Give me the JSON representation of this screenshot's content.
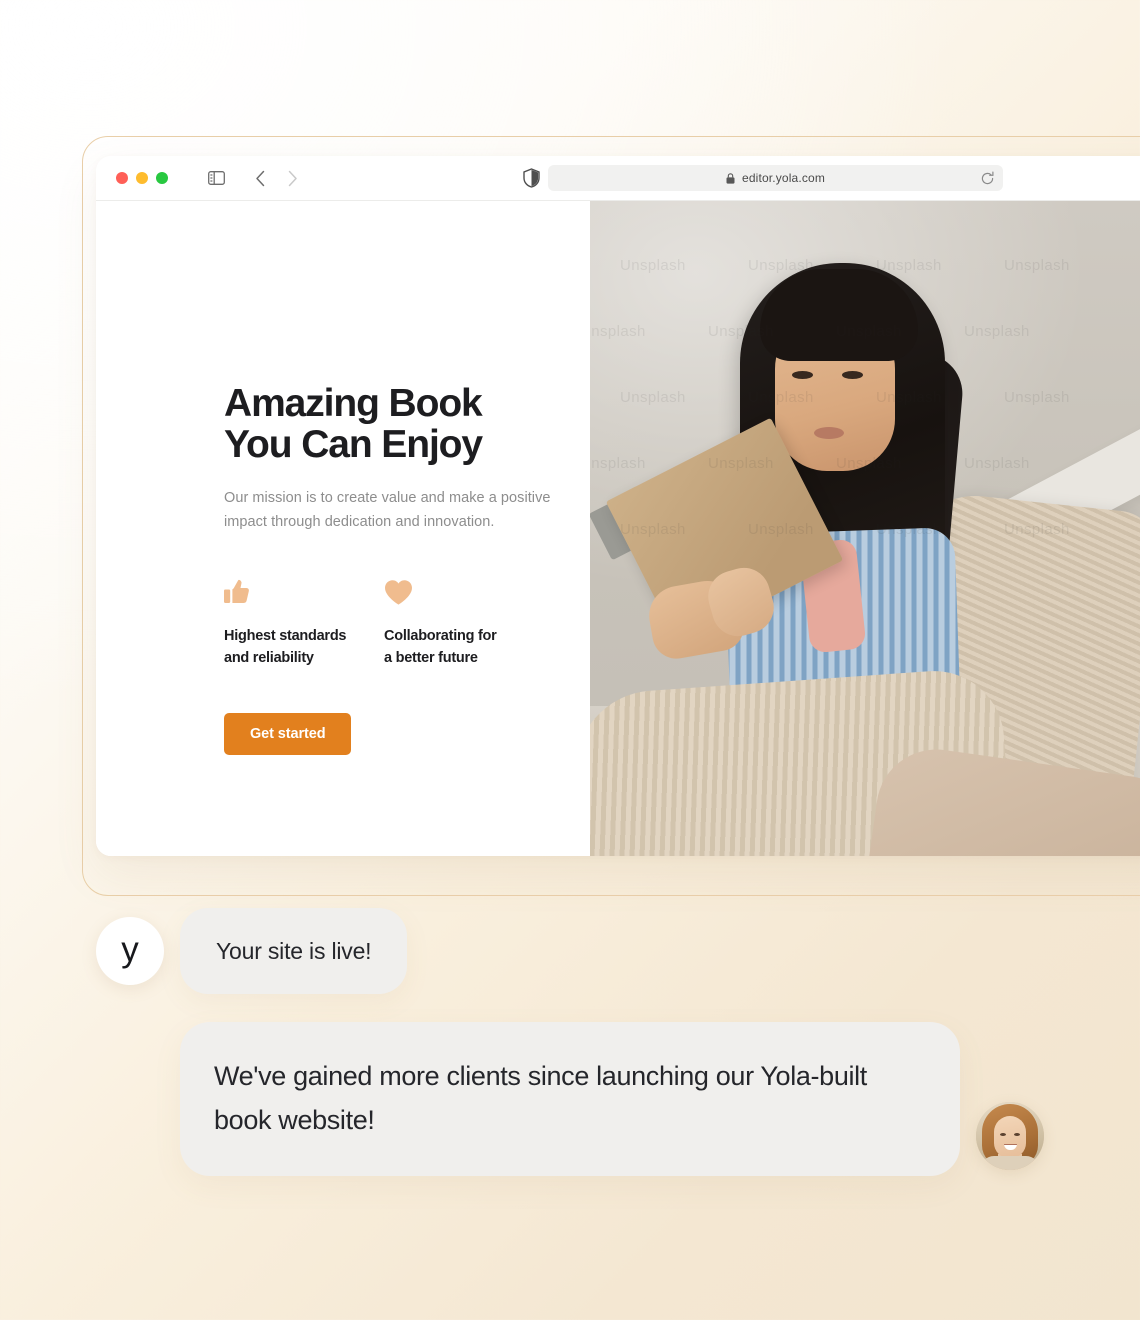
{
  "browser": {
    "traffic_lights": [
      "close",
      "minimize",
      "maximize"
    ],
    "sidebar_toggle_icon": "sidebar-icon",
    "back_icon": "chevron-left-icon",
    "forward_icon": "chevron-right-icon",
    "shield_icon": "shield-icon",
    "lock_icon": "lock-icon",
    "url": "editor.yola.com",
    "reload_icon": "reload-icon"
  },
  "website": {
    "heading": "Amazing Book\nYou Can Enjoy",
    "paragraph": "Our mission is to create value and make a positive impact through dedication and innovation.",
    "features": [
      {
        "icon": "thumbs-up-icon",
        "label": "Highest standards\nand reliability"
      },
      {
        "icon": "heart-icon",
        "label": "Collaborating for\na better future"
      }
    ],
    "cta_label": "Get started",
    "hero_image_alt": "Woman reading a book",
    "hero_watermark": "Unsplash"
  },
  "chat": {
    "messages": [
      {
        "avatar": "yola-logo-avatar",
        "avatar_letter": "y",
        "text": "Your site is live!"
      },
      {
        "avatar": "user-photo-avatar",
        "text": "We've gained more clients since launching our Yola-built book website!"
      }
    ]
  },
  "colors": {
    "accent_orange": "#e2801e",
    "icon_peach": "#f0bc8e",
    "frame_tan": "#e9cfa9",
    "bubble_gray": "#f0efed",
    "text_dark": "#1d1d20",
    "text_muted": "#8d8d8d",
    "bg_cream": "#f2e5cf"
  }
}
